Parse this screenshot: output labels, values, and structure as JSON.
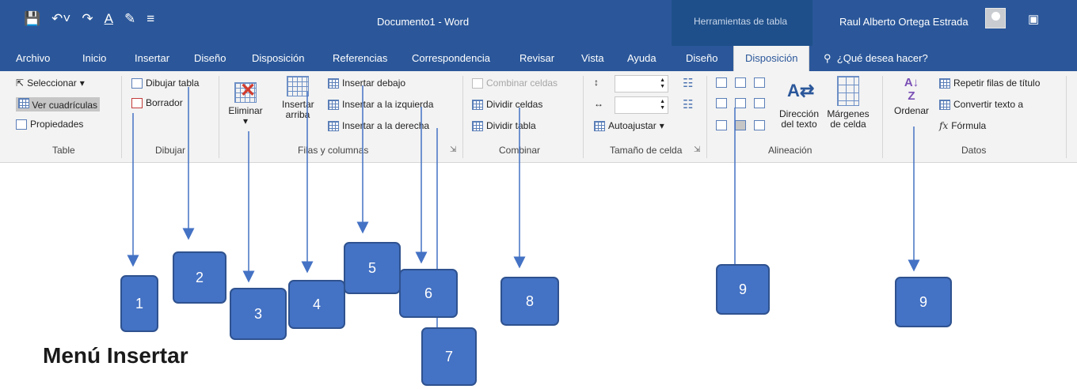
{
  "window": {
    "doc_title": "Documento1 - Word",
    "contextual_title": "Herramientas de tabla",
    "user_name": "Raul Alberto Ortega Estrada"
  },
  "tabs": [
    "Archivo",
    "Inicio",
    "Insertar",
    "Diseño",
    "Disposición",
    "Referencias",
    "Correspondencia",
    "Revisar",
    "Vista",
    "Ayuda",
    "Diseño",
    "Disposición"
  ],
  "active_tab": "Disposición",
  "tell_me": "¿Qué desea hacer?",
  "ribbon": {
    "table": {
      "label": "Table",
      "select": "Seleccionar",
      "gridlines": "Ver cuadrículas",
      "properties": "Propiedades"
    },
    "draw": {
      "label": "Dibujar",
      "draw_table": "Dibujar tabla",
      "eraser": "Borrador"
    },
    "rows_cols": {
      "label": "Filas y columnas",
      "delete": "Eliminar",
      "insert_above_1": "Insertar",
      "insert_above_2": "arriba",
      "insert_below": "Insertar debajo",
      "insert_left": "Insertar a la izquierda",
      "insert_right": "Insertar a la derecha"
    },
    "merge": {
      "label": "Combinar",
      "merge_cells": "Combinar celdas",
      "split_cells": "Dividir celdas",
      "split_table": "Dividir tabla"
    },
    "cell_size": {
      "label": "Tamaño de celda",
      "autofit": "Autoajustar"
    },
    "alignment": {
      "label": "Alineación",
      "text_dir_1": "Dirección",
      "text_dir_2": "del texto",
      "margins_1": "Márgenes",
      "margins_2": "de celda"
    },
    "data": {
      "label": "Datos",
      "sort": "Ordenar",
      "repeat_header": "Repetir filas de título",
      "convert_text": "Convertir texto a",
      "formula": "Fórmula"
    }
  },
  "callouts": [
    "1",
    "2",
    "3",
    "4",
    "5",
    "6",
    "7",
    "8",
    "9",
    "9"
  ],
  "heading": "Menú Insertar"
}
